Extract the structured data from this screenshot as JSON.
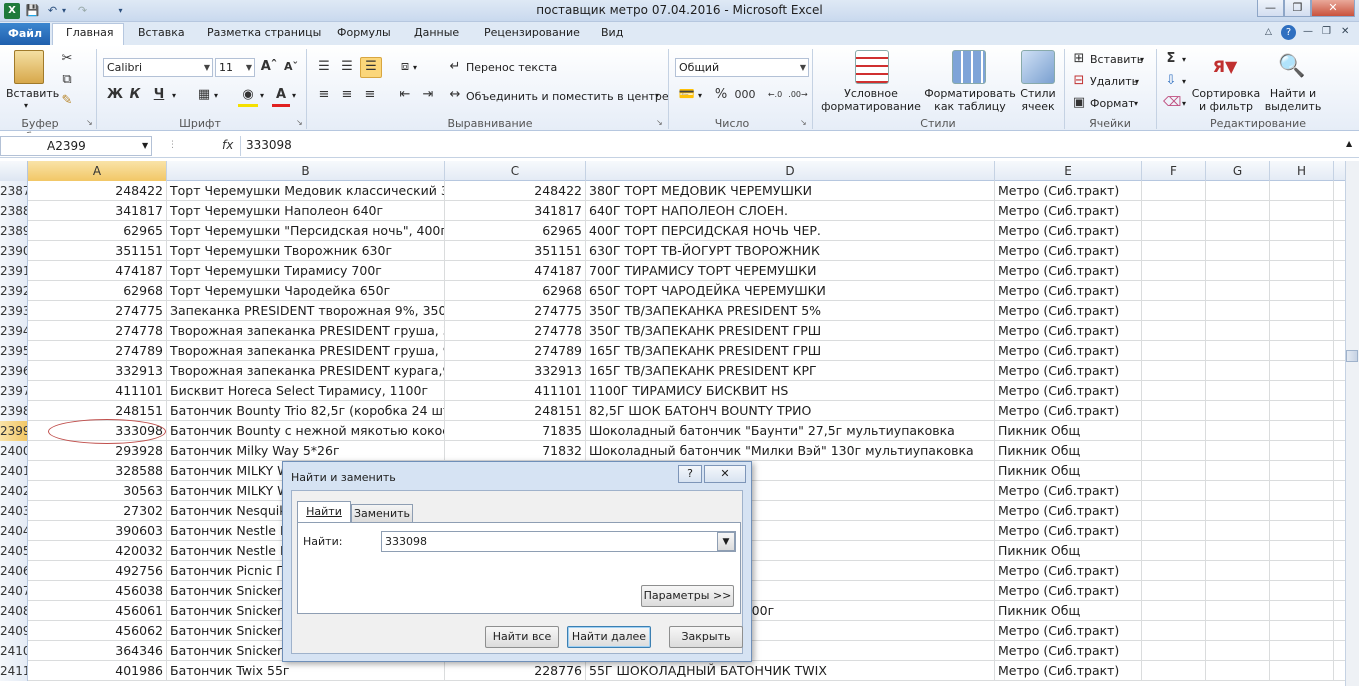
{
  "window": {
    "title": "поставщик метро 07.04.2016  -  Microsoft Excel"
  },
  "ribbon_tabs": {
    "file": "Файл",
    "home": "Главная",
    "insert": "Вставка",
    "layout": "Разметка страницы",
    "formulas": "Формулы",
    "data": "Данные",
    "review": "Рецензирование",
    "view": "Вид"
  },
  "ribbon": {
    "clipboard": {
      "label": "Буфер обмена",
      "paste": "Вставить"
    },
    "font": {
      "label": "Шрифт",
      "name": "Calibri",
      "size": "11",
      "bold": "Ж",
      "italic": "К",
      "underline": "Ч"
    },
    "alignment": {
      "label": "Выравнивание",
      "wrap": "Перенос текста",
      "merge": "Объединить и поместить в центре"
    },
    "number": {
      "label": "Число",
      "format": "Общий",
      "percent": "%",
      "thousands": "000"
    },
    "styles": {
      "label": "Стили",
      "conditional": "Условное форматирование",
      "as_table": "Форматировать как таблицу",
      "cell_styles": "Стили ячеек"
    },
    "cells": {
      "label": "Ячейки",
      "insert": "Вставить",
      "delete": "Удалить",
      "format": "Формат"
    },
    "editing": {
      "label": "Редактирование",
      "sort": "Сортировка и фильтр",
      "find": "Найти и выделить"
    }
  },
  "formula_bar": {
    "name_box": "A2399",
    "fx": "fx",
    "value": "333098"
  },
  "columns": [
    "A",
    "B",
    "C",
    "D",
    "E",
    "F",
    "G",
    "H"
  ],
  "rows": [
    {
      "n": "2387",
      "a": "248422",
      "b": "Торт Черемушки Медовик классический 38",
      "c": "248422",
      "d": "380Г ТОРТ МЕДОВИК ЧЕРЕМУШКИ",
      "e": "Метро (Сиб.тракт)"
    },
    {
      "n": "2388",
      "a": "341817",
      "b": "Торт Черемушки Наполеон 640г",
      "c": "341817",
      "d": "640Г ТОРТ НАПОЛЕОН СЛОЕН.",
      "e": "Метро (Сиб.тракт)"
    },
    {
      "n": "2389",
      "a": "62965",
      "b": "Торт Черемушки \"Персидская ночь\", 400г",
      "c": "62965",
      "d": "400Г ТОРТ ПЕРСИДСКАЯ НОЧЬ ЧЕР.",
      "e": "Метро (Сиб.тракт)"
    },
    {
      "n": "2390",
      "a": "351151",
      "b": "Торт Черемушки Творожник 630г",
      "c": "351151",
      "d": "630Г ТОРТ ТВ-ЙОГУРТ ТВОРОЖНИК",
      "e": "Метро (Сиб.тракт)"
    },
    {
      "n": "2391",
      "a": "474187",
      "b": "Торт Черемушки Тирамису 700г",
      "c": "474187",
      "d": "700Г ТИРАМИСУ ТОРТ ЧЕРЕМУШКИ",
      "e": "Метро (Сиб.тракт)"
    },
    {
      "n": "2392",
      "a": "62968",
      "b": "Торт Черемушки Чародейка 650г",
      "c": "62968",
      "d": "650Г ТОРТ ЧАРОДЕЙКА ЧЕРЕМУШКИ",
      "e": "Метро (Сиб.тракт)"
    },
    {
      "n": "2393",
      "a": "274775",
      "b": "Запеканка PRESIDENT творожная 9%, 350г",
      "c": "274775",
      "d": "350Г ТВ/ЗАПЕКАНКА PRESIDENT 5%",
      "e": "Метро (Сиб.тракт)"
    },
    {
      "n": "2394",
      "a": "274778",
      "b": "Творожная запеканка PRESIDENT груша, 350",
      "c": "274778",
      "d": "350Г ТВ/ЗАПЕКАНК PRESIDENT ГРШ",
      "e": "Метро (Сиб.тракт)"
    },
    {
      "n": "2395",
      "a": "274789",
      "b": "Творожная запеканка PRESIDENT груша, 9%",
      "c": "274789",
      "d": "165Г ТВ/ЗАПЕКАНК PRESIDENT ГРШ",
      "e": "Метро (Сиб.тракт)"
    },
    {
      "n": "2396",
      "a": "332913",
      "b": "Творожная запеканка PRESIDENT курага,9%",
      "c": "332913",
      "d": "165Г ТВ/ЗАПЕКАНК PRESIDENT КРГ",
      "e": "Метро (Сиб.тракт)"
    },
    {
      "n": "2397",
      "a": "411101",
      "b": "Бисквит Horeca Select Тирамису, 1100г",
      "c": "411101",
      "d": "1100Г ТИРАМИСУ БИСКВИТ HS",
      "e": "Метро (Сиб.тракт)"
    },
    {
      "n": "2398",
      "a": "248151",
      "b": "Батончик Bounty Trio 82,5г (коробка 24 штук",
      "c": "248151",
      "d": "82,5Г ШОК БАТОНЧ BOUNTY ТРИО",
      "e": "Метро (Сиб.тракт)"
    },
    {
      "n": "2399",
      "a": "333098",
      "b": "Батончик Bounty с нежной мякотью кокоса",
      "c": "71835",
      "d": "Шоколадный батончик \"Баунти\" 27,5г мультиупаковка",
      "e": "Пикник Общ"
    },
    {
      "n": "2400",
      "a": "293928",
      "b": "Батончик Milky Way 5*26г",
      "c": "71832",
      "d": "Шоколадный батончик \"Милки Вэй\" 130г мультиупаковка",
      "e": "Пикник Общ"
    },
    {
      "n": "2401",
      "a": "328588",
      "b": "Батончик MILKY W",
      "c": "",
      "d": "илки Вэй\" 52г",
      "e": "Пикник Общ"
    },
    {
      "n": "2402",
      "a": "30563",
      "b": "Батончик MILKY W",
      "c": "",
      "d": "WAY",
      "e": "Метро (Сиб.тракт)"
    },
    {
      "n": "2403",
      "a": "27302",
      "b": "Батончик Nesquik",
      "c": "",
      "d": "К) КОНФ",
      "e": "Метро (Сиб.тракт)"
    },
    {
      "n": "2404",
      "a": "390603",
      "b": "Батончик Nestle N",
      "c": "",
      "d": "ЛЬТИПАК",
      "e": "Метро (Сиб.тракт)"
    },
    {
      "n": "2405",
      "a": "420032",
      "b": "Батончик Nestle N",
      "c": "",
      "d": "тс\" 50г",
      "e": "Пикник Общ"
    },
    {
      "n": "2406",
      "a": "492756",
      "b": "Батончик Picnic Гр",
      "c": "",
      "d": "РЕЦ ОРЕХ",
      "e": "Метро (Сиб.тракт)"
    },
    {
      "n": "2407",
      "a": "456038",
      "b": "Батончик Snickers",
      "c": "",
      "d": "S",
      "e": "Метро (Сиб.тракт)"
    },
    {
      "n": "2408",
      "a": "456061",
      "b": "Батончик Snickers",
      "c": "",
      "d": "икерс мультиупаковка 200г",
      "e": "Пикник Общ"
    },
    {
      "n": "2409",
      "a": "456062",
      "b": "Батончик Snickers",
      "c": "",
      "d": "S",
      "e": "Метро (Сиб.тракт)"
    },
    {
      "n": "2410",
      "a": "364346",
      "b": "Батончик Snickers",
      "c": "",
      "d": "РЕХОМ",
      "e": "Метро (Сиб.тракт)"
    },
    {
      "n": "2411",
      "a": "401986",
      "b": "Батончик Twix 55г",
      "c": "228776",
      "d": "55Г ШОКОЛАДНЫЙ БАТОНЧИК TWIX",
      "e": "Метро (Сиб.тракт)"
    }
  ],
  "dialog": {
    "title": "Найти и заменить",
    "help": "?",
    "tab_find": "Найти",
    "tab_replace": "Заменить",
    "find_label": "Найти:",
    "find_value": "333098",
    "params_button": "Параметры >>",
    "find_all": "Найти все",
    "find_next": "Найти далее",
    "close": "Закрыть"
  }
}
